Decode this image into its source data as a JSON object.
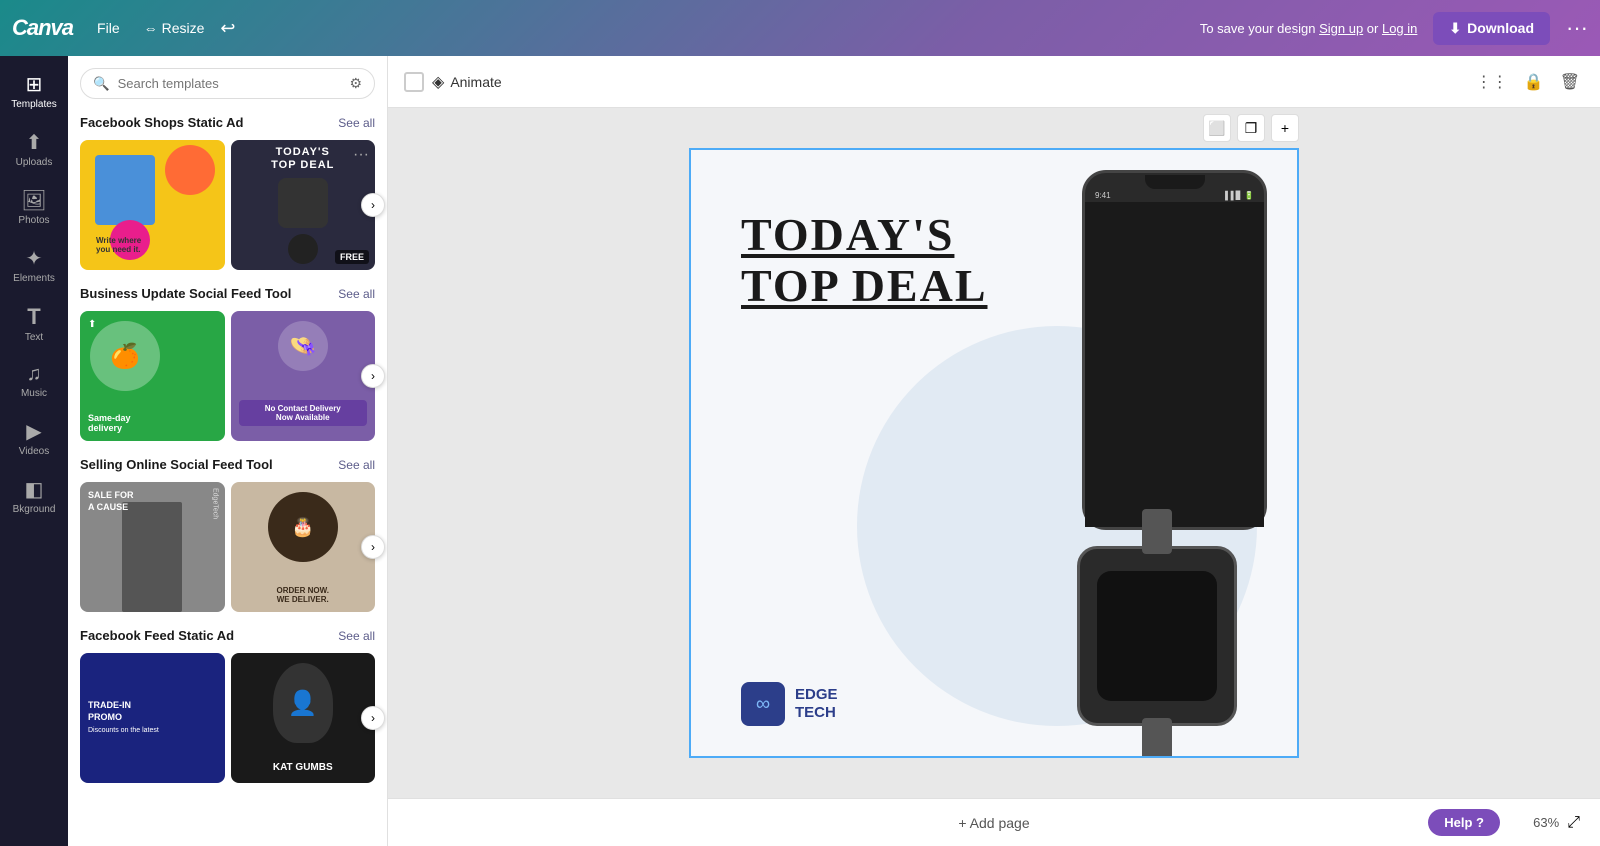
{
  "topbar": {
    "logo": "Canva",
    "file_label": "File",
    "resize_label": "Resize",
    "undo_symbol": "↩",
    "save_text": "To save your design ",
    "sign_up": "Sign up",
    "or": " or ",
    "log_in": "Log in",
    "download_label": "Download",
    "more_symbol": "···"
  },
  "sidebar": {
    "items": [
      {
        "id": "templates",
        "label": "Templates",
        "icon": "⊞",
        "active": true
      },
      {
        "id": "uploads",
        "label": "Uploads",
        "icon": "⬆"
      },
      {
        "id": "photos",
        "label": "Photos",
        "icon": "🖼"
      },
      {
        "id": "elements",
        "label": "Elements",
        "icon": "✦"
      },
      {
        "id": "text",
        "label": "Text",
        "icon": "T"
      },
      {
        "id": "music",
        "label": "Music",
        "icon": "♫"
      },
      {
        "id": "videos",
        "label": "Videos",
        "icon": "▶"
      },
      {
        "id": "background",
        "label": "Bkground",
        "icon": "◧"
      }
    ]
  },
  "search": {
    "placeholder": "Search templates"
  },
  "sections": [
    {
      "id": "facebook-shops",
      "title": "Facebook Shops Static Ad",
      "see_all": "See all",
      "templates": [
        {
          "id": "fb1",
          "type": "yellow",
          "has_free": false
        },
        {
          "id": "fb2",
          "type": "dark",
          "has_free": true,
          "badge": "FREE"
        }
      ]
    },
    {
      "id": "business-update",
      "title": "Business Update Social Feed Tool",
      "see_all": "See all",
      "templates": [
        {
          "id": "bu1",
          "type": "green",
          "text": "Same-day delivery",
          "has_free": false
        },
        {
          "id": "bu2",
          "type": "purple",
          "text": "No Contact Delivery Now Available",
          "has_free": false
        }
      ]
    },
    {
      "id": "selling-online",
      "title": "Selling Online Social Feed Tool",
      "see_all": "See all",
      "templates": [
        {
          "id": "so1",
          "type": "gray",
          "text": "SALE FOR A CAUSE",
          "has_free": false
        },
        {
          "id": "so2",
          "type": "beige",
          "text": "ORDER NOW. WE DELIVER.",
          "has_free": false
        }
      ]
    },
    {
      "id": "facebook-feed",
      "title": "Facebook Feed Static Ad",
      "see_all": "See all",
      "templates": [
        {
          "id": "ff1",
          "type": "navy",
          "text": "TRADE-IN PROMO",
          "has_free": false
        },
        {
          "id": "ff2",
          "type": "dark2",
          "text": "KAT GUMBS",
          "has_free": false
        }
      ]
    }
  ],
  "canvas_toolbar": {
    "animate_label": "Animate"
  },
  "design": {
    "title_line1": "TODAY'S",
    "title_line2": "TOP DEAL",
    "brand_name_line1": "EDGE",
    "brand_name_line2": "TECH",
    "phone_time": "9:41"
  },
  "bottom_bar": {
    "add_page": "+ Add page",
    "zoom": "63%",
    "help": "Help ?"
  },
  "frame_controls": {
    "frame_icon": "⬜",
    "copy_icon": "❐",
    "add_icon": "+"
  }
}
